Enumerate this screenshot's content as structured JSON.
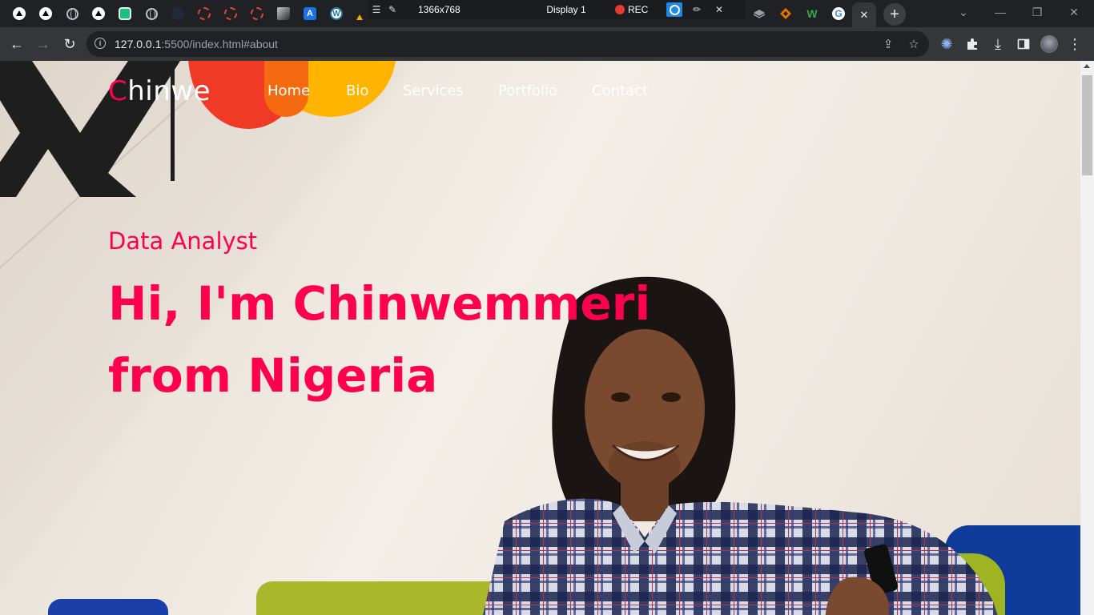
{
  "browser": {
    "tabs": [
      {
        "icon": "triangle-icon"
      },
      {
        "icon": "triangle-icon"
      },
      {
        "icon": "globe-icon"
      },
      {
        "icon": "triangle-icon"
      },
      {
        "icon": "chatgpt-icon"
      },
      {
        "icon": "globe-icon"
      },
      {
        "icon": "dark-circle-icon"
      },
      {
        "icon": "red-ring-icon"
      },
      {
        "icon": "red-ring-icon"
      },
      {
        "icon": "red-ring-icon"
      },
      {
        "icon": "photo-icon"
      },
      {
        "icon": "a-letter-icon"
      },
      {
        "icon": "wordpress-icon"
      },
      {
        "icon": "warning-icon"
      }
    ],
    "a_favicon_letter": "A",
    "wp_favicon_letter": "W",
    "recorder": {
      "resolution": "1366x768",
      "display": "Display 1",
      "rec_label": "REC"
    },
    "right_tabs": [
      {
        "icon": "layers-icon"
      },
      {
        "icon": "diamond-icon"
      },
      {
        "icon": "w-letter-icon"
      },
      {
        "icon": "google-icon"
      }
    ],
    "w_favicon_letter": "W",
    "google_letter": "G",
    "new_tab": "+",
    "close_tab": "✕",
    "url_host": "127.0.0.1",
    "url_rest": ":5500/index.html#about",
    "accent": "#ff004f"
  },
  "site": {
    "logo_first": "C",
    "logo_rest": "hinwe",
    "nav": [
      "Home",
      "Bio",
      "Services",
      "Portfolio",
      "Contact"
    ],
    "hero_subtitle": "Data Analyst",
    "hero_line1": "Hi, I'm Chinwemmeri",
    "hero_line2": "from Nigeria"
  }
}
